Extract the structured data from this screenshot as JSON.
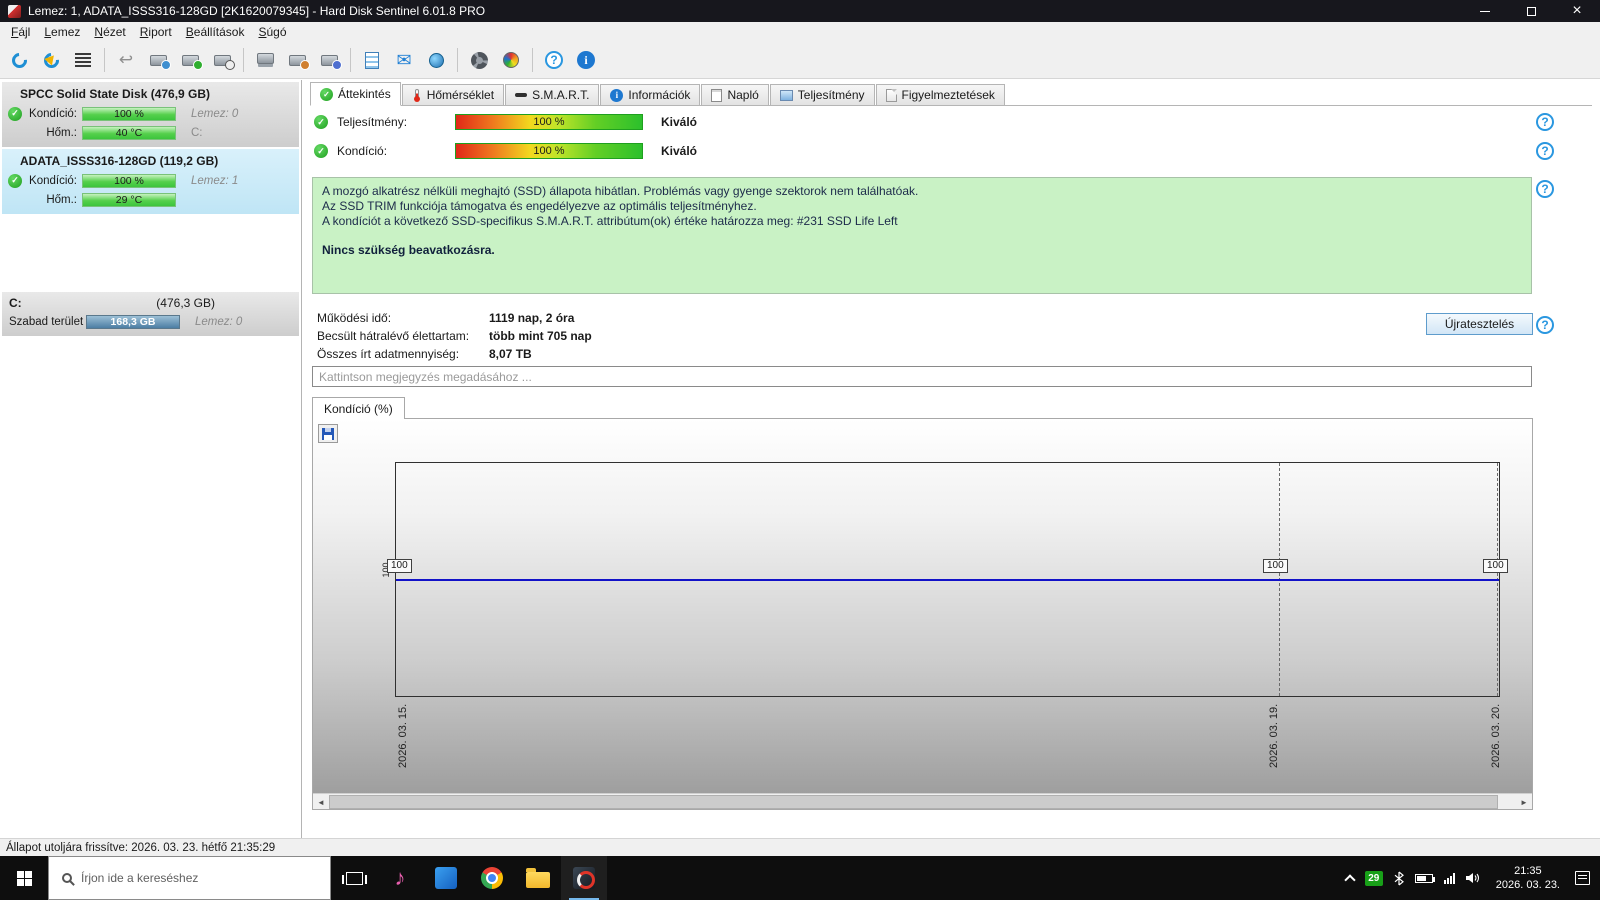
{
  "window": {
    "title": "Lemez: 1, ADATA_ISSS316-128GD [2K1620079345]  -  Hard Disk Sentinel 6.01.8 PRO"
  },
  "menu": {
    "items": [
      "Fájl",
      "Lemez",
      "Nézet",
      "Riport",
      "Beállítások",
      "Súgó"
    ]
  },
  "toolbar": {
    "icons": [
      "refresh",
      "refresh-warning",
      "surface-test",
      "undo",
      "disk-schedule",
      "disk-check",
      "disk-analyze",
      "disk-copy",
      "disk-export",
      "disk-import",
      "report-list",
      "send-email",
      "disk-online",
      "settings-gear",
      "color-gauge",
      "help",
      "info"
    ]
  },
  "sidebar": {
    "disks": [
      {
        "name": "SPCC Solid State Disk (476,9 GB)",
        "condition_label": "Kondíció:",
        "condition_value": "100 %",
        "disk_label": "Lemez: 0",
        "temp_label": "Hőm.:",
        "temp_value": "40 °C",
        "drive_letter": "C:"
      },
      {
        "name": "ADATA_ISSS316-128GD (119,2 GB)",
        "condition_label": "Kondíció:",
        "condition_value": "100 %",
        "disk_label": "Lemez: 1",
        "temp_label": "Hőm.:",
        "temp_value": "29 °C",
        "drive_letter": ""
      }
    ],
    "partition": {
      "name": "C:",
      "size": "(476,3 GB)",
      "free_label": "Szabad terület",
      "free_value": "168,3 GB",
      "disk_label": "Lemez: 0"
    }
  },
  "main": {
    "tabs": [
      {
        "label": "Áttekintés",
        "active": true
      },
      {
        "label": "Hőmérséklet",
        "active": false
      },
      {
        "label": "S.M.A.R.T.",
        "active": false
      },
      {
        "label": "Információk",
        "active": false
      },
      {
        "label": "Napló",
        "active": false
      },
      {
        "label": "Teljesítmény",
        "active": false
      },
      {
        "label": "Figyelmeztetések",
        "active": false
      }
    ],
    "overview": {
      "performance": {
        "label": "Teljesítmény:",
        "value": "100 %",
        "rating": "Kiváló"
      },
      "condition": {
        "label": "Kondíció:",
        "value": "100 %",
        "rating": "Kiváló"
      },
      "status_lines": [
        "A mozgó alkatrész nélküli meghajtó (SSD) állapota hibátlan. Problémás vagy gyenge szektorok nem találhatóak.",
        "Az SSD TRIM funkciója támogatva és engedélyezve az optimális teljesítményhez.",
        "A kondíciót a következő SSD-specifikus S.M.A.R.T. attribútum(ok) értéke határozza meg:  #231 SSD Life Left"
      ],
      "status_bold": "Nincs szükség beavatkozásra.",
      "details": [
        {
          "label": "Működési idő:",
          "value": "1119 nap, 2 óra"
        },
        {
          "label": "Becsült hátralévő élettartam:",
          "value": "több mint 705 nap"
        },
        {
          "label": "Összes írt adatmennyiség:",
          "value": "8,07 TB"
        }
      ],
      "retest_label": "Újratesztelés",
      "comment_placeholder": "Kattintson megjegyzés megadásához ..."
    }
  },
  "chart_data": {
    "type": "line",
    "title": "Kondíció  (%)",
    "x": [
      "2026. 03. 15.",
      "2026. 03. 19.",
      "2026. 03. 20."
    ],
    "series": [
      {
        "name": "Kondíció (%)",
        "values": [
          100,
          100,
          100
        ]
      }
    ],
    "point_labels": [
      "100",
      "100",
      "100"
    ],
    "y_axis_visible_tick": "100",
    "line_color": "#1212c8",
    "grid": "dashed-vertical-at-dates",
    "legend": "none"
  },
  "status_bar": {
    "text": "Állapot utoljára frissítve: 2026. 03. 23. hétfő 21:35:29"
  },
  "taskbar": {
    "search_placeholder": "Írjon ide a kereséshez",
    "tray_badge": "29",
    "time": "21:35",
    "date": "2026. 03. 23."
  },
  "colors": {
    "health_gradient_end": "#2cc02c",
    "selected_disk_bg": "#c9eaf6",
    "status_box_bg": "#c9f2c5",
    "graph_line": "#1212c8",
    "tray_badge_bg": "#18a018"
  }
}
